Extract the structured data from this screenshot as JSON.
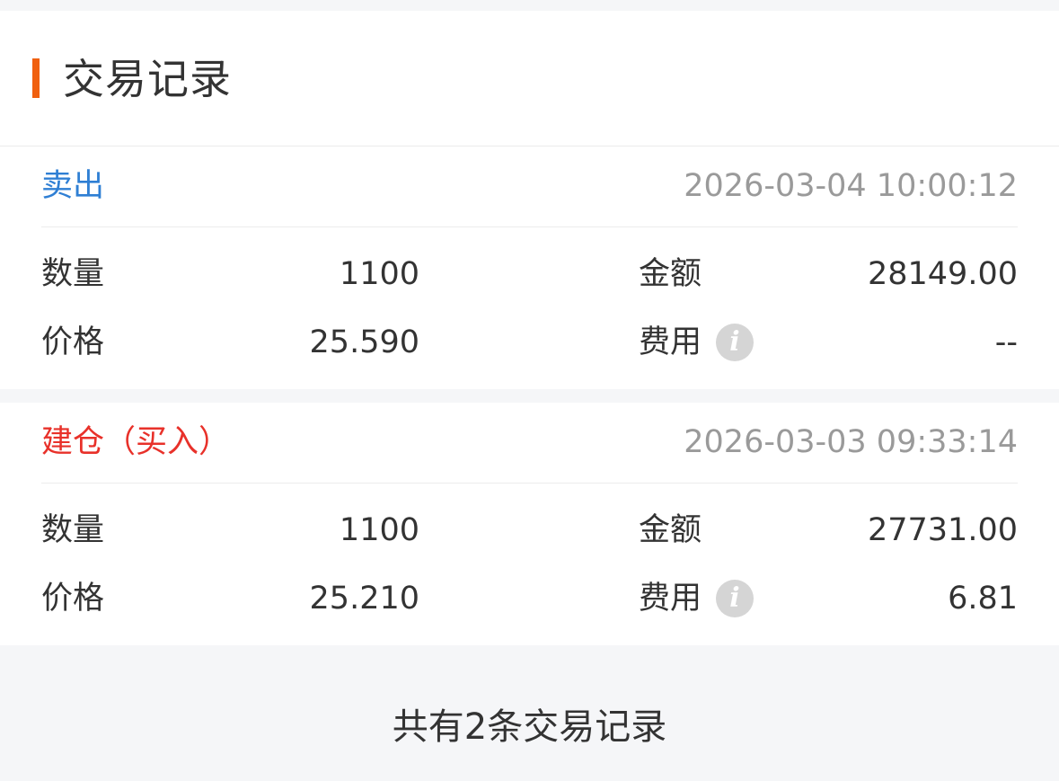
{
  "header": {
    "title": "交易记录",
    "accent_color": "#f0600f"
  },
  "trades": [
    {
      "type": "卖出",
      "type_color": "#2f7fd4",
      "time": "2026-03-04 10:00:12",
      "quantity_label": "数量",
      "quantity": "1100",
      "amount_label": "金额",
      "amount": "28149.00",
      "price_label": "价格",
      "price": "25.590",
      "fee_label": "费用",
      "fee_icon": "info-icon",
      "fee_icon_glyph": "i",
      "fee": "--"
    },
    {
      "type": "建仓（买入）",
      "type_color": "#e8312a",
      "time": "2026-03-03 09:33:14",
      "quantity_label": "数量",
      "quantity": "1100",
      "amount_label": "金额",
      "amount": "27731.00",
      "price_label": "价格",
      "price": "25.210",
      "fee_label": "费用",
      "fee_icon": "info-icon",
      "fee_icon_glyph": "i",
      "fee": "6.81"
    }
  ],
  "footer": {
    "summary": "共有2条交易记录"
  }
}
